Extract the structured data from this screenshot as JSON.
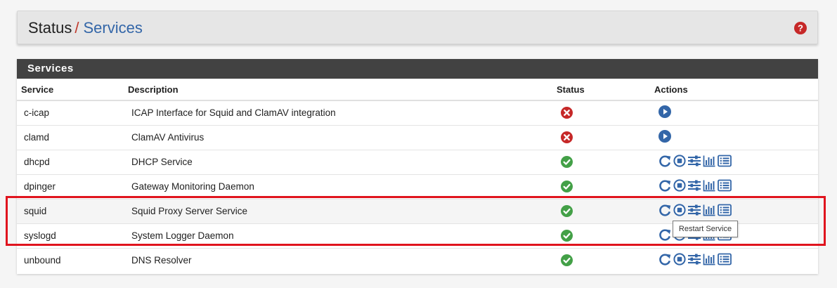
{
  "breadcrumb": {
    "parent": "Status",
    "separator": "/",
    "current": "Services"
  },
  "header": {
    "help_icon": "question-circle-icon"
  },
  "panel": {
    "title": "Services"
  },
  "table": {
    "columns": [
      "Service",
      "Description",
      "Status",
      "Actions"
    ],
    "rows": [
      {
        "service": "c-icap",
        "description": "ICAP Interface for Squid and ClamAV integration",
        "status": "stopped"
      },
      {
        "service": "clamd",
        "description": "ClamAV Antivirus",
        "status": "stopped"
      },
      {
        "service": "dhcpd",
        "description": "DHCP Service",
        "status": "running"
      },
      {
        "service": "dpinger",
        "description": "Gateway Monitoring Daemon",
        "status": "running"
      },
      {
        "service": "squid",
        "description": "Squid Proxy Server Service",
        "status": "running"
      },
      {
        "service": "syslogd",
        "description": "System Logger Daemon",
        "status": "running"
      },
      {
        "service": "unbound",
        "description": "DNS Resolver",
        "status": "running"
      }
    ]
  },
  "tooltip": {
    "text": "Restart Service"
  },
  "colors": {
    "accent": "#3366a8",
    "stopped": "#c62828",
    "running": "#43a047",
    "panel_heading": "#424242",
    "highlight": "#e0141e"
  }
}
